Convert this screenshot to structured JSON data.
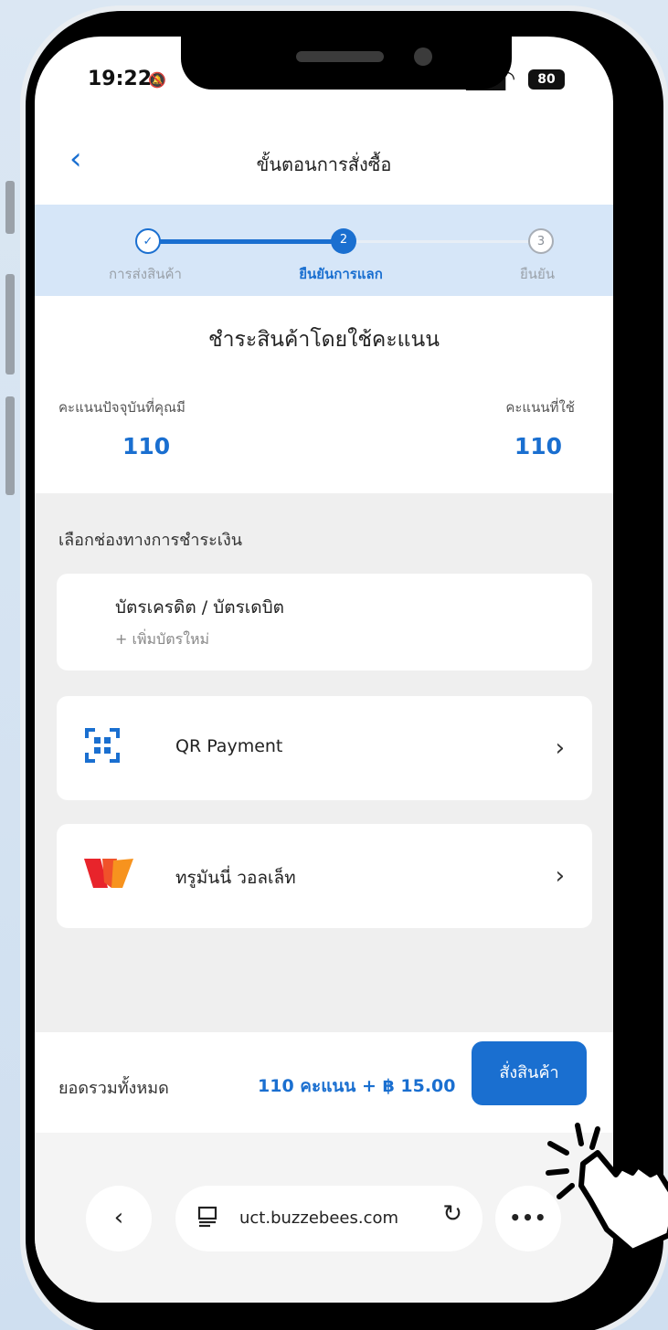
{
  "status_bar": {
    "time": "19:22",
    "battery": "80"
  },
  "header": {
    "title": "ขั้นตอนการสั่งซื้อ"
  },
  "steps": [
    {
      "number": "",
      "label": "การส่งสินค้า"
    },
    {
      "number": "2",
      "label": "ยืนยันการแลก"
    },
    {
      "number": "3",
      "label": "ยืนยัน"
    }
  ],
  "points": {
    "heading": "ชำระสินค้าโดยใช้คะแนน",
    "current_label": "คะแนนปัจจุบันที่คุณมี",
    "current_value": "110",
    "used_label": "คะแนนที่ใช้",
    "used_value": "110"
  },
  "payment": {
    "section_title": "เลือกช่องทางการชำระเงิน",
    "credit_title": "บัตรเครดิต / บัตรเดบิต",
    "credit_add": "+ เพิ่มบัตรใหม่",
    "qr_label": "QR Payment",
    "truemoney_label": "ทรูมันนี่ วอลเล็ท"
  },
  "footer": {
    "total_label": "ยอดรวมทั้งหมด",
    "total_value": "110 คะแนน + ฿ 15.00",
    "order_button": "สั่งสินค้า"
  },
  "browser": {
    "url": "uct.buzzebees.com"
  },
  "colors": {
    "accent": "#1a6fd0",
    "steps_bg": "#d6e6f8",
    "page_bg": "#efefef"
  }
}
